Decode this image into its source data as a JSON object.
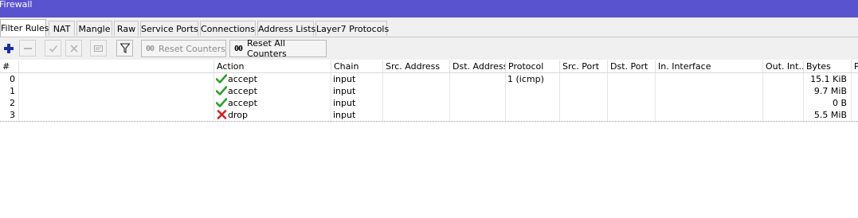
{
  "window": {
    "title": "Firewall"
  },
  "tabs": [
    {
      "label": "Filter Rules",
      "active": true
    },
    {
      "label": "NAT"
    },
    {
      "label": "Mangle"
    },
    {
      "label": "Raw"
    },
    {
      "label": "Service Ports"
    },
    {
      "label": "Connections"
    },
    {
      "label": "Address Lists"
    },
    {
      "label": "Layer7 Protocols"
    }
  ],
  "toolbar": {
    "add_icon": "plus-icon",
    "remove_icon": "minus-icon",
    "enable_icon": "check-icon",
    "disable_icon": "cross-icon",
    "comment_icon": "comment-icon",
    "filter_icon": "filter-icon",
    "reset_counters_label": "Reset Counters",
    "reset_all_counters_label": "Reset All Counters",
    "counter_glyph": "00"
  },
  "table": {
    "columns": [
      "#",
      "",
      "Action",
      "Chain",
      "Src. Address",
      "Dst. Address",
      "Protocol",
      "Src. Port",
      "Dst. Port",
      "In. Interface",
      "Out. Int...",
      "Bytes",
      "P"
    ],
    "rows": [
      {
        "num": "0",
        "action": "accept",
        "action_icon": "check-icon",
        "chain": "input",
        "src_address": "",
        "dst_address": "",
        "protocol": "1 (icmp)",
        "src_port": "",
        "dst_port": "",
        "in_interface": "",
        "out_interface": "",
        "bytes": "15.1 KiB"
      },
      {
        "num": "1",
        "action": "accept",
        "action_icon": "check-icon",
        "chain": "input",
        "src_address": "",
        "dst_address": "",
        "protocol": "",
        "src_port": "",
        "dst_port": "",
        "in_interface": "",
        "out_interface": "",
        "bytes": "9.7 MiB"
      },
      {
        "num": "2",
        "action": "accept",
        "action_icon": "check-icon",
        "chain": "input",
        "src_address": "",
        "dst_address": "",
        "protocol": "",
        "src_port": "",
        "dst_port": "",
        "in_interface": "",
        "out_interface": "",
        "bytes": "0 B"
      },
      {
        "num": "3",
        "action": "drop",
        "action_icon": "cross-icon",
        "chain": "input",
        "src_address": "",
        "dst_address": "",
        "protocol": "",
        "src_port": "",
        "dst_port": "",
        "in_interface": "",
        "out_interface": "",
        "bytes": "5.5 MiB"
      }
    ]
  },
  "colors": {
    "titlebar": "#5a53d0",
    "accept_green": "#2e9e2e",
    "drop_red": "#d42020",
    "add_blue": "#1a2fa0"
  }
}
